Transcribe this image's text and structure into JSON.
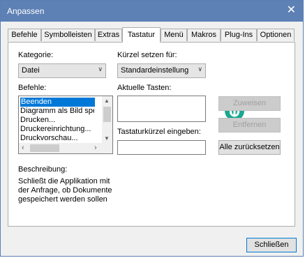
{
  "window": {
    "title": "Anpassen",
    "close_glyph": "✕"
  },
  "tabs": [
    {
      "label": "Befehle",
      "active": false
    },
    {
      "label": "Symbolleisten",
      "active": false
    },
    {
      "label": "Extras",
      "active": false
    },
    {
      "label": "Tastatur",
      "active": true
    },
    {
      "label": "Menü",
      "active": false
    },
    {
      "label": "Makros",
      "active": false
    },
    {
      "label": "Plug-Ins",
      "active": false
    },
    {
      "label": "Optionen",
      "active": false
    }
  ],
  "kategorie": {
    "label": "Kategorie:",
    "value": "Datei"
  },
  "kuerzel": {
    "label": "Kürzel setzen für:",
    "value": "Standardeinstellung"
  },
  "befehle": {
    "label": "Befehle:",
    "items": [
      "Beenden",
      "Diagramm als Bild speichern...",
      "Drucken...",
      "Druckereinrichtung...",
      "Druckvorschau..."
    ],
    "selected_index": 0
  },
  "aktuelle_tasten": {
    "label": "Aktuelle Tasten:"
  },
  "tastaturkuerzel": {
    "label": "Tastaturkürzel eingeben:",
    "value": ""
  },
  "buttons": {
    "zuweisen": "Zuweisen",
    "entfernen": "Entfernen",
    "alle_zuruecksetzen": "Alle zurücksetzen",
    "schliessen": "Schließen"
  },
  "beschreibung": {
    "label": "Beschreibung:",
    "text": "Schließt die Applikation mit der Anfrage, ob Dokumente gespeichert werden sollen"
  },
  "colors": {
    "titlebar": "#5d80b5",
    "selection": "#0078d7",
    "logo": "#1aa88f"
  }
}
